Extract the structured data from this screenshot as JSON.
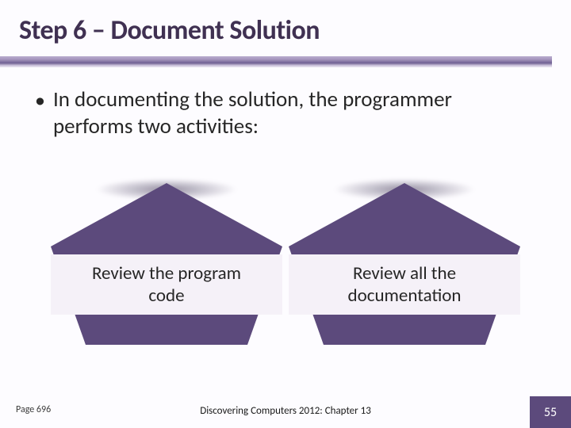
{
  "title": "Step 6 – Document Solution",
  "bullet": "In documenting the solution, the programmer performs two activities:",
  "shapes": [
    {
      "label": "Review the program code"
    },
    {
      "label": "Review all the documentation"
    }
  ],
  "footer": {
    "page_ref": "Page 696",
    "chapter": "Discovering Computers 2012: Chapter 13",
    "slide_number": "55"
  },
  "colors": {
    "accent": "#5c4a7c",
    "title_text": "#403152",
    "band_bg": "#f5f1f8"
  }
}
